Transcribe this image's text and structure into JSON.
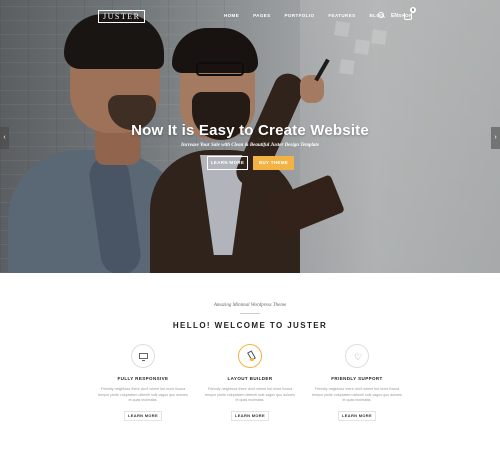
{
  "nav": {
    "logo": "JUSTER",
    "items": [
      "HOME",
      "PAGES",
      "PORTFOLIO",
      "FEATURES",
      "BLOG",
      "SHOP"
    ],
    "language": "EN",
    "cart_count": "0"
  },
  "hero": {
    "title": "Now It is Easy to Create Website",
    "subtitle": "Increase Your Sale with Clean & Beautiful Juster Design Template",
    "learn_more": "LEARN MORE",
    "buy_theme": "BUY THEME",
    "arrow_prev": "‹",
    "arrow_next": "›"
  },
  "welcome": {
    "tagline": "Amazing Minimal Wordpress Theme",
    "heading": "HELLO! WELCOME TO JUSTER"
  },
  "features": [
    {
      "icon": "monitor-icon",
      "title": "FULLY RESPONSIVE",
      "desc": "Friendly neighbour there don't where but more Iloona tempor pinite voluptatem deleniti nulk vagus quo dolores et quas molestias.",
      "button": "LEARN MORE"
    },
    {
      "icon": "brush-icon",
      "title": "LAYOUT BUILDER",
      "desc": "Friendly neighbour there don't where but more Iloona tempor pinite voluptatem deleniti nulk vagus quo dolores et quas molestias.",
      "button": "LEARN MORE"
    },
    {
      "icon": "heart-icon",
      "title": "FRIENDLY SUPPORT",
      "desc": "Friendly neighbour there don't where but more Iloona tempor pinite voluptatem deleniti nulk vagus quo dolores et quas molestias.",
      "button": "LEARN MORE"
    }
  ],
  "colors": {
    "accent": "#f3b244",
    "text_dark": "#222222",
    "text_muted": "#999999"
  }
}
